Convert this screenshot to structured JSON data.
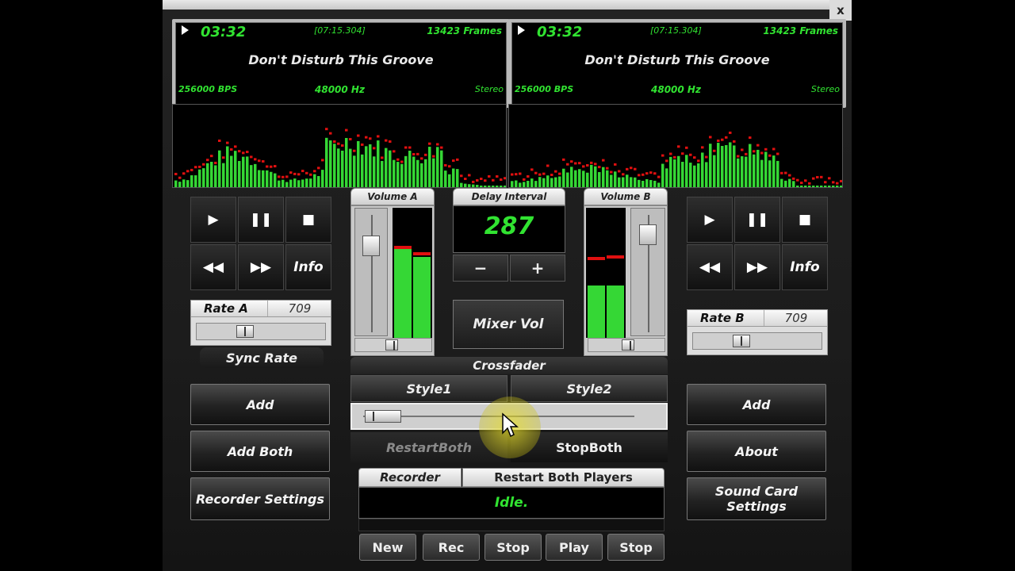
{
  "window": {
    "close_label": "x"
  },
  "deck_a": {
    "time": "03:32",
    "elapsed": "[07:15.304]",
    "frames": "13423 Frames",
    "title": "Don't Disturb This Groove",
    "bps": "256000 BPS",
    "hz": "48000 Hz",
    "channels": "Stereo",
    "rate_label": "Rate A",
    "rate_value": "709",
    "sync_label": "Sync Rate",
    "add_label": "Add",
    "add_both_label": "Add Both",
    "recorder_settings_label": "Recorder Settings",
    "info_label": "Info"
  },
  "deck_b": {
    "time": "03:32",
    "elapsed": "[07:15.304]",
    "frames": "13423 Frames",
    "title": "Don't Disturb This Groove",
    "bps": "256000 BPS",
    "hz": "48000 Hz",
    "channels": "Stereo",
    "rate_label": "Rate B",
    "rate_value": "709",
    "add_label": "Add",
    "about_label": "About",
    "sound_card_label": "Sound Card Settings",
    "info_label": "Info"
  },
  "mixer": {
    "volume_a_label": "Volume A",
    "volume_b_label": "Volume B",
    "delay_label": "Delay Interval",
    "delay_value": "287",
    "minus_label": "−",
    "plus_label": "+",
    "mixer_vol_label": "Mixer Vol",
    "crossfader_label": "Crossfader",
    "style1_label": "Style1",
    "style2_label": "Style2",
    "restart_both_label": "RestartBoth",
    "stop_both_label": "StopBoth",
    "volume_a_level": 0.75,
    "volume_b_level": 0.85,
    "vu_a_levels": [
      0.7,
      0.62
    ],
    "vu_b_levels": [
      0.4,
      0.4
    ]
  },
  "recorder": {
    "tab_label": "Recorder",
    "restart_tab_label": "Restart Both Players",
    "status": "Idle.",
    "buttons": [
      "New",
      "Rec",
      "Stop",
      "Play",
      "Stop"
    ]
  },
  "colors": {
    "accent_green": "#31e331",
    "peak_red": "#e01010"
  },
  "icons": {
    "play": "play-icon",
    "pause": "pause-icon",
    "stop": "stop-icon",
    "rewind": "rewind-icon",
    "forward": "fast-forward-icon"
  }
}
